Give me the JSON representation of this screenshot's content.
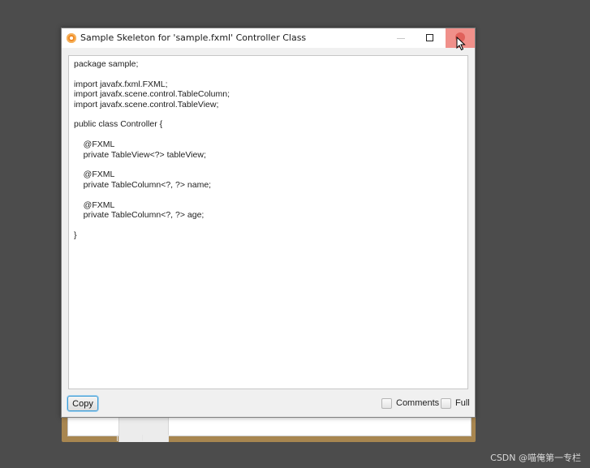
{
  "window": {
    "title": "Sample Skeleton for 'sample.fxml' Controller Class",
    "icon": "java-app-icon"
  },
  "editor": {
    "code": "package sample;\n\nimport javafx.fxml.FXML;\nimport javafx.scene.control.TableColumn;\nimport javafx.scene.control.TableView;\n\npublic class Controller {\n\n    @FXML\n    private TableView<?> tableView;\n\n    @FXML\n    private TableColumn<?, ?> name;\n\n    @FXML\n    private TableColumn<?, ?> age;\n\n}"
  },
  "footer": {
    "copy_label": "Copy",
    "comments_label": "Comments",
    "full_label": "Full",
    "comments_checked": false,
    "full_checked": false
  },
  "watermark": "CSDN @喵俺第一专栏",
  "colors": {
    "close_hover": "#f0908a",
    "copy_focus": "#3a9bd5",
    "desktop": "#4c4c4c"
  }
}
